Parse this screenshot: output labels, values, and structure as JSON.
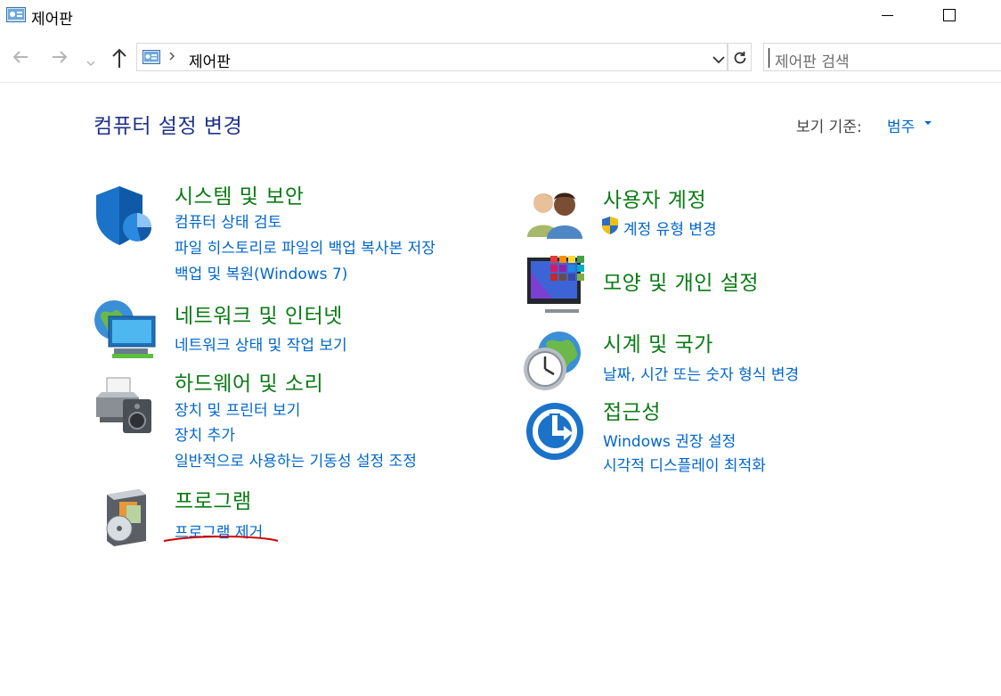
{
  "window": {
    "title": "제어판"
  },
  "address_bar": {
    "path": "제어판",
    "search_placeholder": "제어판 검색"
  },
  "header": {
    "title": "컴퓨터 설정 변경",
    "view_by_label": "보기 기준:",
    "view_by_value": "범주"
  },
  "categories": {
    "system_security": {
      "title": "시스템 및 보안",
      "links": [
        "컴퓨터 상태 검토",
        "파일 히스토리로 파일의 백업 복사본 저장",
        "백업 및 복원(Windows 7)"
      ]
    },
    "network": {
      "title": "네트워크 및 인터넷",
      "links": [
        "네트워크 상태 및 작업 보기"
      ]
    },
    "hardware": {
      "title": "하드웨어 및 소리",
      "links": [
        "장치 및 프린터 보기",
        "장치 추가",
        "일반적으로 사용하는 기동성 설정 조정"
      ]
    },
    "programs": {
      "title": "프로그램",
      "links": [
        "프로그램 제거"
      ]
    },
    "user_accounts": {
      "title": "사용자 계정",
      "links": [
        "계정 유형 변경"
      ]
    },
    "appearance": {
      "title": "모양 및 개인 설정",
      "links": []
    },
    "clock_region": {
      "title": "시계 및 국가",
      "links": [
        "날짜, 시간 또는 숫자 형식 변경"
      ]
    },
    "ease_of_access": {
      "title": "접근성",
      "links": [
        "Windows 권장 설정",
        "시각적 디스플레이 최적화"
      ]
    }
  },
  "colors": {
    "category_title": "#0a7a14",
    "link": "#0066cc",
    "page_title": "#1e3287",
    "annotation": "#d40000"
  },
  "icons": {
    "app": "control-panel-icon",
    "system_security": "shield-icon",
    "network": "network-globe-icon",
    "hardware": "printer-speaker-icon",
    "programs": "programs-disc-icon",
    "user_accounts": "users-icon",
    "appearance": "display-tiles-icon",
    "clock_region": "clock-globe-icon",
    "ease_of_access": "ease-of-access-icon",
    "uac": "uac-shield-icon"
  }
}
